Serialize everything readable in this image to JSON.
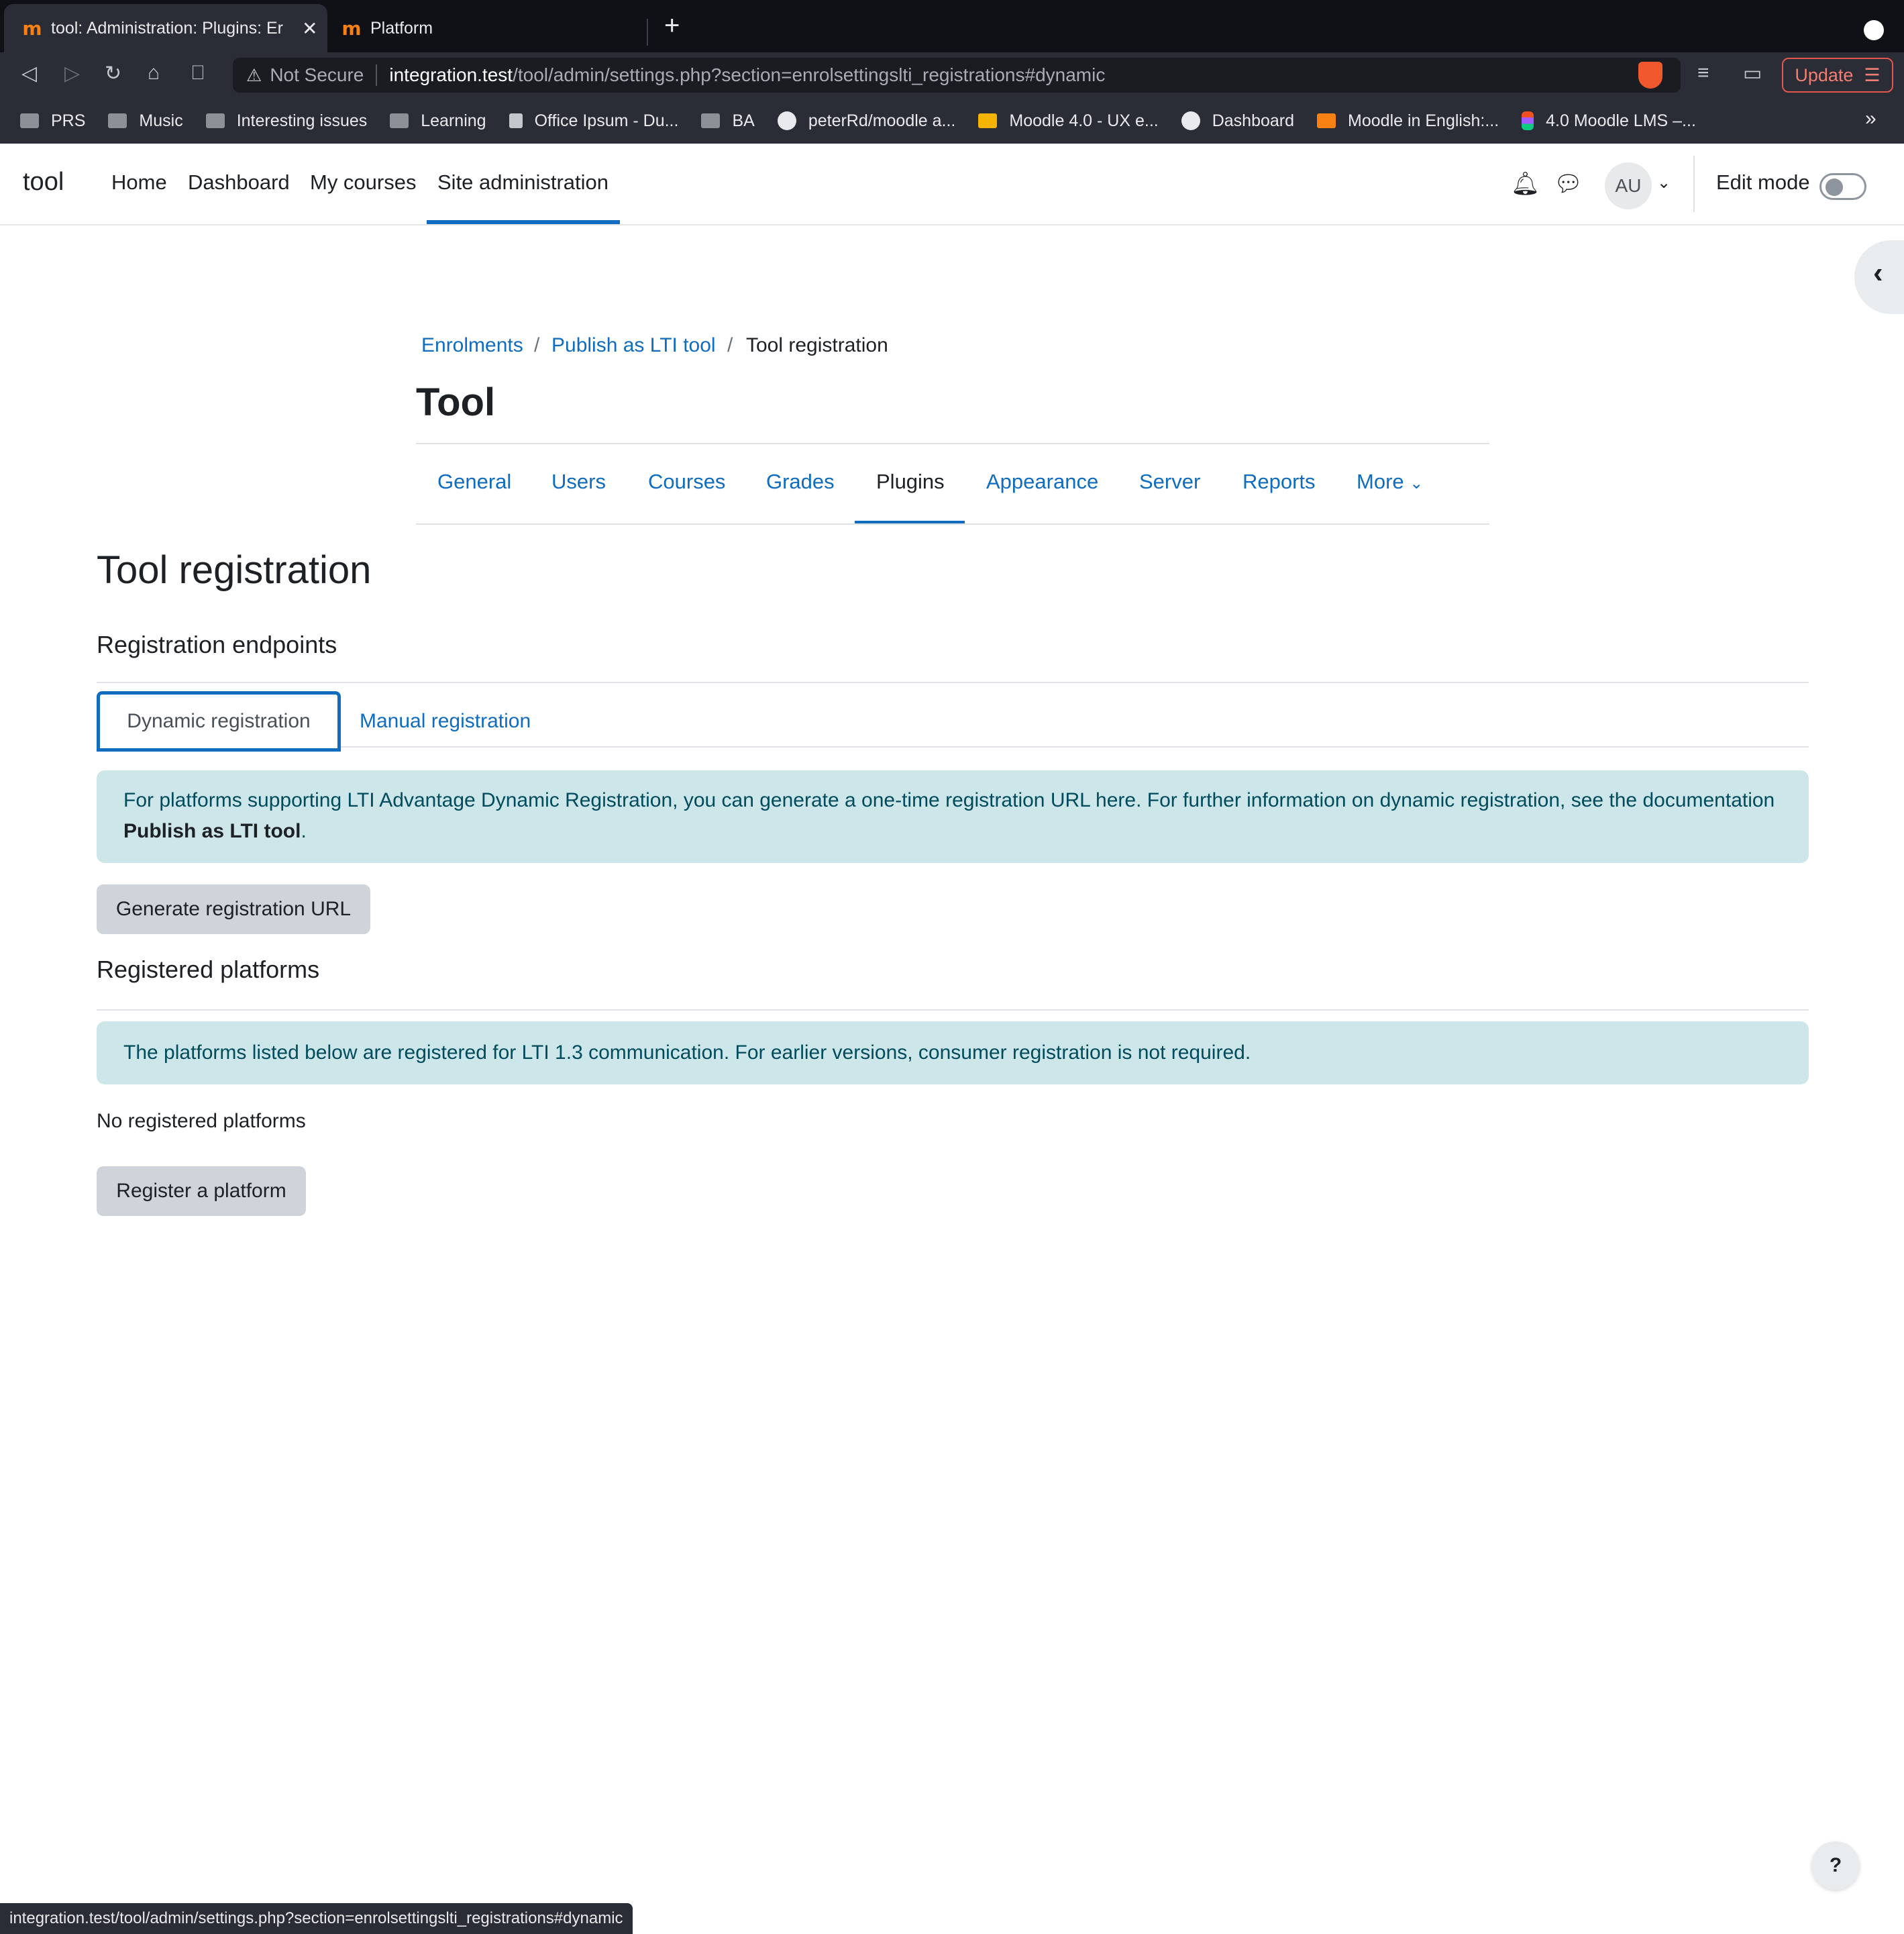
{
  "browser": {
    "tabs": [
      {
        "title": "tool: Administration: Plugins: Er",
        "active": true
      },
      {
        "title": "Platform",
        "active": false
      }
    ],
    "new_tab": "+",
    "close": "✕",
    "security_label": "Not Secure",
    "url_host": "integration.test",
    "url_path": "/tool/admin/settings.php?section=enrolsettingslti_registrations#dynamic",
    "update_label": "Update",
    "bookmarks": [
      {
        "label": "PRS",
        "icon": "folder-icon"
      },
      {
        "label": "Music",
        "icon": "folder-icon"
      },
      {
        "label": "Interesting issues",
        "icon": "folder-icon"
      },
      {
        "label": "Learning",
        "icon": "folder-icon"
      },
      {
        "label": "Office Ipsum - Du...",
        "icon": "office-ipsum-icon"
      },
      {
        "label": "BA",
        "icon": "folder-icon"
      },
      {
        "label": "peterRd/moodle a...",
        "icon": "github-icon"
      },
      {
        "label": "Moodle 4.0 - UX e...",
        "icon": "slides-icon"
      },
      {
        "label": "Dashboard",
        "icon": "globe-icon"
      },
      {
        "label": "Moodle in English:...",
        "icon": "moodle-icon"
      },
      {
        "label": "4.0 Moodle LMS –...",
        "icon": "figma-icon"
      }
    ],
    "bookmarks_more": "»",
    "status_url": "integration.test/tool/admin/settings.php?section=enrolsettingslti_registrations#dynamic"
  },
  "moodle_nav": {
    "brand": "tool",
    "primary": [
      "Home",
      "Dashboard",
      "My courses",
      "Site administration"
    ],
    "active_primary": "Site administration",
    "avatar_initials": "AU",
    "edit_mode_label": "Edit mode",
    "edit_mode_on": false
  },
  "breadcrumb": [
    "Enrolments",
    "Publish as LTI tool",
    "Tool registration"
  ],
  "page_title": "Tool",
  "secondary_nav": {
    "items": [
      "General",
      "Users",
      "Courses",
      "Grades",
      "Plugins",
      "Appearance",
      "Server",
      "Reports",
      "More"
    ],
    "active": "Plugins"
  },
  "main": {
    "heading": "Tool registration",
    "endpoints_heading": "Registration endpoints",
    "tabs": [
      "Dynamic registration",
      "Manual registration"
    ],
    "active_tab": "Dynamic registration",
    "dynamic_info_text": "For platforms supporting LTI Advantage Dynamic Registration, you can generate a one-time registration URL here. For further information on dynamic registration, see the documentation ",
    "dynamic_info_link": "Publish as LTI tool",
    "dynamic_info_end": ".",
    "generate_button": "Generate registration URL",
    "registered_heading": "Registered platforms",
    "registered_info": "The platforms listed below are registered for LTI 1.3 communication. For earlier versions, consumer registration is not required.",
    "no_platforms": "No registered platforms",
    "register_button": "Register a platform"
  },
  "help_label": "?",
  "colors": {
    "primary": "#0f6cbf",
    "alert_bg": "#cce6ea",
    "alert_text": "#004b5c",
    "secondary_btn": "#ced4da",
    "update_accent": "#e2584e"
  }
}
